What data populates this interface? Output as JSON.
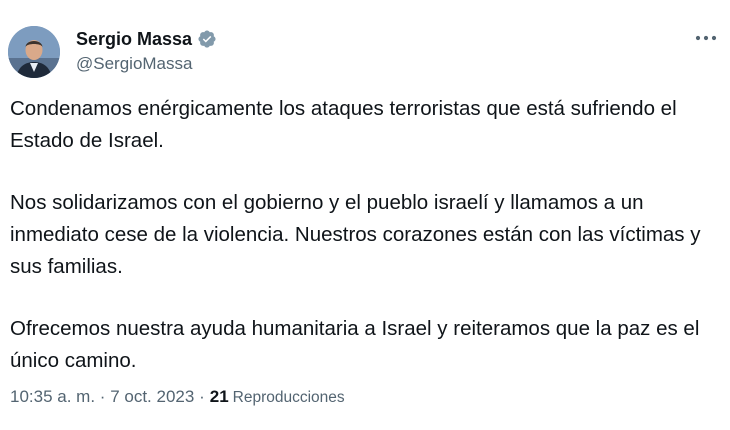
{
  "author": {
    "display_name": "Sergio Massa",
    "handle": "@SergioMassa",
    "verified_icon": "verified-badge-icon",
    "avatar_icon": "avatar-photo"
  },
  "more_icon": "more-options-icon",
  "tweet": {
    "paragraphs": [
      "Condenamos enérgicamente los ataques terroristas que está sufriendo el Estado de Israel.",
      "Nos solidarizamos con el gobierno y el pueblo israelí y llamamos a un inmediato cese de la violencia. Nuestros corazones están con las víctimas y sus familias.",
      "Ofrecemos nuestra ayuda humanitaria a Israel y reiteramos que la paz es el único camino."
    ]
  },
  "meta": {
    "time": "10:35 a. m.",
    "separator1": "·",
    "date": "7 oct. 2023",
    "separator2": "·",
    "views_count": "21",
    "views_label": "Reproducciones"
  },
  "colors": {
    "text": "#0f1419",
    "secondary": "#536471",
    "verified": "#829aab"
  }
}
